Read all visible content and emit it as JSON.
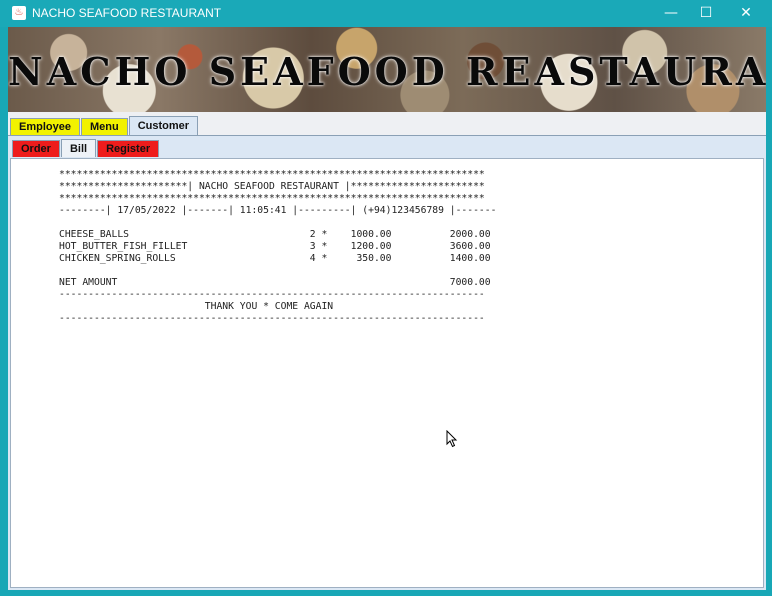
{
  "window": {
    "title": "NACHO SEAFOOD RESTAURANT",
    "icon": "java-cup-icon",
    "controls": {
      "minimize": "—",
      "maximize": "☐",
      "close": "✕"
    }
  },
  "banner": {
    "text": "NACHO SEAFOOD REASTAURANT"
  },
  "tabs": [
    {
      "label": "Employee",
      "color": "#f2f200"
    },
    {
      "label": "Menu",
      "color": "#f2f200"
    },
    {
      "label": "Customer",
      "color": "#dbe7f4",
      "selected": true
    }
  ],
  "subtabs": [
    {
      "label": "Order",
      "color": "#ee1c1c"
    },
    {
      "label": "Bill",
      "color": "#eef2f7",
      "selected": true
    },
    {
      "label": "Register",
      "color": "#ee1c1c"
    }
  ],
  "receipt": {
    "lines": [
      "*************************************************************************",
      "**********************| NACHO SEAFOOD RESTAURANT |***********************",
      "*************************************************************************",
      "--------| 17/05/2022 |-------| 11:05:41 |---------| (+94)123456789 |-------",
      "",
      "CHEESE_BALLS                               2 *    1000.00          2000.00",
      "HOT_BUTTER_FISH_FILLET                     3 *    1200.00          3600.00",
      "CHICKEN_SPRING_ROLLS                       4 *     350.00          1400.00",
      "",
      "NET AMOUNT                                                         7000.00",
      "-------------------------------------------------------------------------",
      "                         THANK YOU * COME AGAIN",
      "-------------------------------------------------------------------------"
    ]
  }
}
